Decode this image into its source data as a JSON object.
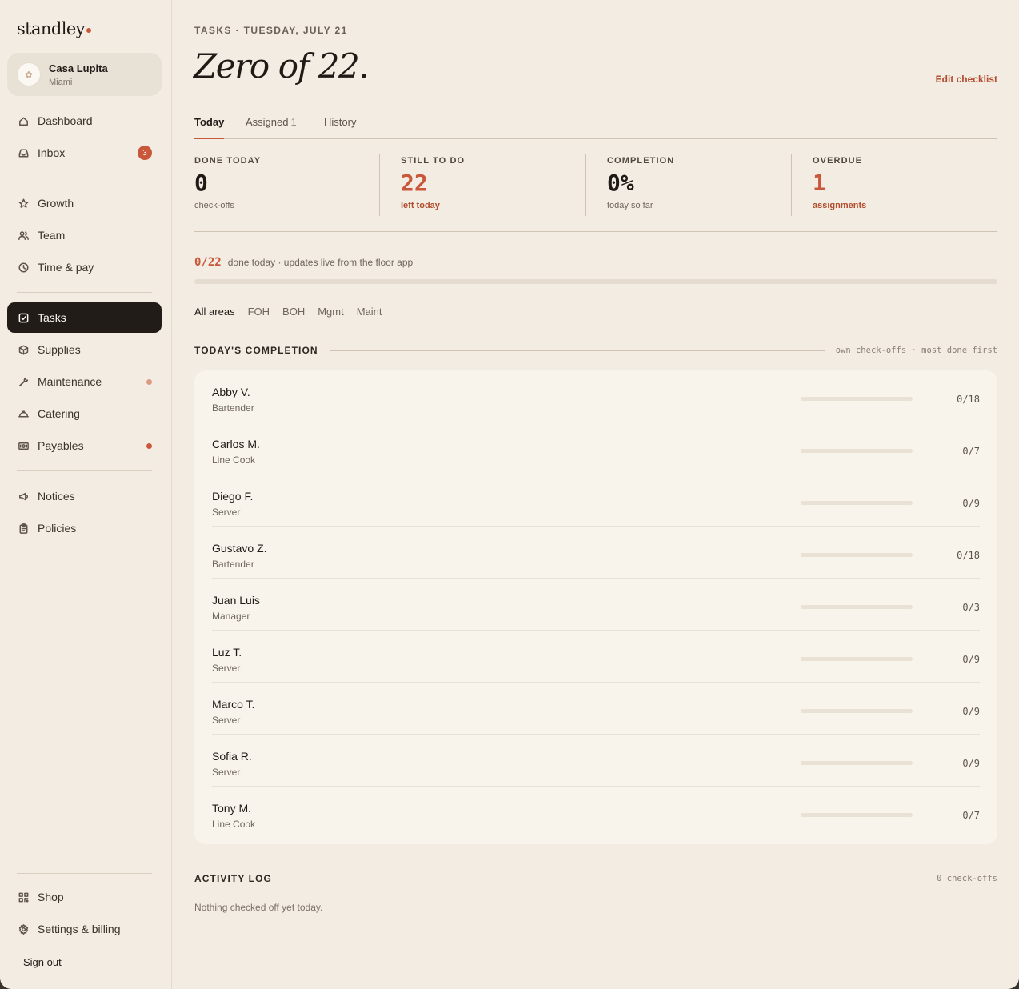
{
  "brand": {
    "name": "standley"
  },
  "venue": {
    "name": "Casa Lupita",
    "city": "Miami"
  },
  "nav": {
    "primary": [
      {
        "label": "Dashboard",
        "icon": "home-icon"
      },
      {
        "label": "Inbox",
        "icon": "inbox-icon",
        "badge": "3"
      }
    ],
    "secondary": [
      {
        "label": "Growth",
        "icon": "star-icon"
      },
      {
        "label": "Team",
        "icon": "users-icon"
      },
      {
        "label": "Time & pay",
        "icon": "clock-icon"
      }
    ],
    "ops": [
      {
        "label": "Tasks",
        "icon": "checkbox-icon",
        "active": true
      },
      {
        "label": "Supplies",
        "icon": "box-icon"
      },
      {
        "label": "Maintenance",
        "icon": "wrench-icon",
        "dot": "faint"
      },
      {
        "label": "Catering",
        "icon": "cloche-icon"
      },
      {
        "label": "Payables",
        "icon": "cash-icon",
        "dot": "solid"
      }
    ],
    "info": [
      {
        "label": "Notices",
        "icon": "megaphone-icon"
      },
      {
        "label": "Policies",
        "icon": "clipboard-icon"
      }
    ],
    "footer": [
      {
        "label": "Shop",
        "icon": "qr-icon"
      },
      {
        "label": "Settings & billing",
        "icon": "gear-icon"
      }
    ],
    "signout": "Sign out"
  },
  "header": {
    "kicker": "TASKS · TUESDAY, JULY 21",
    "title": "Zero of 22.",
    "edit_label": "Edit checklist"
  },
  "tabs": [
    {
      "label": "Today",
      "active": true
    },
    {
      "label": "Assigned",
      "count": "1"
    },
    {
      "label": "History"
    }
  ],
  "stats": [
    {
      "label": "DONE TODAY",
      "value": "0",
      "sub": "check-offs",
      "accent": false
    },
    {
      "label": "STILL TO DO",
      "value": "22",
      "sub": "left today",
      "accent": true
    },
    {
      "label": "COMPLETION",
      "value": "0%",
      "sub": "today so far",
      "accent": false
    },
    {
      "label": "OVERDUE",
      "value": "1",
      "sub": "assignments",
      "accent": true
    }
  ],
  "progress": {
    "fraction": "0/22",
    "text": "done today · updates live from the floor app",
    "percent": 0
  },
  "areas": [
    {
      "label": "All areas",
      "active": true
    },
    {
      "label": "FOH"
    },
    {
      "label": "BOH"
    },
    {
      "label": "Mgmt"
    },
    {
      "label": "Maint"
    }
  ],
  "completion": {
    "title": "TODAY'S COMPLETION",
    "note": "own check-offs · most done first",
    "rows": [
      {
        "name": "Abby V.",
        "role": "Bartender",
        "done": 0,
        "total": 18,
        "count": "0/18"
      },
      {
        "name": "Carlos M.",
        "role": "Line Cook",
        "done": 0,
        "total": 7,
        "count": "0/7"
      },
      {
        "name": "Diego F.",
        "role": "Server",
        "done": 0,
        "total": 9,
        "count": "0/9"
      },
      {
        "name": "Gustavo Z.",
        "role": "Bartender",
        "done": 0,
        "total": 18,
        "count": "0/18"
      },
      {
        "name": "Juan Luis",
        "role": "Manager",
        "done": 0,
        "total": 3,
        "count": "0/3"
      },
      {
        "name": "Luz T.",
        "role": "Server",
        "done": 0,
        "total": 9,
        "count": "0/9"
      },
      {
        "name": "Marco T.",
        "role": "Server",
        "done": 0,
        "total": 9,
        "count": "0/9"
      },
      {
        "name": "Sofia R.",
        "role": "Server",
        "done": 0,
        "total": 9,
        "count": "0/9"
      },
      {
        "name": "Tony M.",
        "role": "Line Cook",
        "done": 0,
        "total": 7,
        "count": "0/7"
      }
    ]
  },
  "activity": {
    "title": "ACTIVITY LOG",
    "note": "0 check-offs",
    "empty": "Nothing checked off yet today."
  },
  "colors": {
    "accent": "#c9573a",
    "active_nav": "#221c18",
    "background": "#f2ece2",
    "card": "#f8f4ec"
  }
}
